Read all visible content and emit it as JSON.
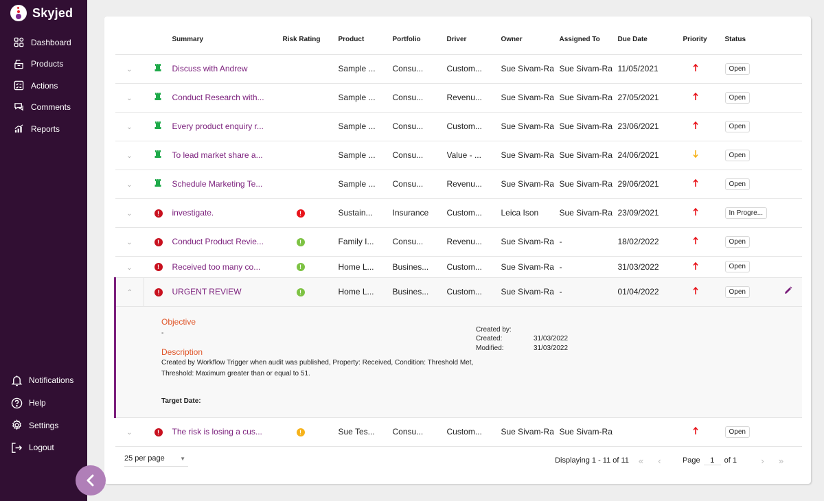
{
  "app": {
    "name": "Skyjed"
  },
  "sidebar": {
    "items": [
      {
        "label": "Dashboard",
        "icon": "dashboard-icon"
      },
      {
        "label": "Products",
        "icon": "products-icon"
      },
      {
        "label": "Actions",
        "icon": "actions-icon"
      },
      {
        "label": "Comments",
        "icon": "comments-icon"
      },
      {
        "label": "Reports",
        "icon": "reports-icon"
      }
    ],
    "bottom_items": [
      {
        "label": "Notifications",
        "icon": "bell-icon"
      },
      {
        "label": "Help",
        "icon": "help-icon"
      },
      {
        "label": "Settings",
        "icon": "gear-icon"
      },
      {
        "label": "Logout",
        "icon": "logout-icon"
      }
    ],
    "collapse_icon": "chevron-left-icon"
  },
  "table": {
    "columns": [
      "",
      "",
      "Summary",
      "Risk Rating",
      "Product",
      "Portfolio",
      "Driver",
      "Owner",
      "Assigned To",
      "Due Date",
      "Priority",
      "Status"
    ],
    "rows": [
      {
        "type": "tower",
        "summary": "Discuss with Andrew",
        "risk": "",
        "product": "Sample ...",
        "portfolio": "Consu...",
        "driver": "Custom...",
        "owner": "Sue Sivam-Ra",
        "assigned": "Sue Sivam-Ra",
        "due": "11/05/2021",
        "priority": "up",
        "status": "Open"
      },
      {
        "type": "tower",
        "summary": "Conduct Research with...",
        "risk": "",
        "product": "Sample ...",
        "portfolio": "Consu...",
        "driver": "Revenu...",
        "owner": "Sue Sivam-Ra",
        "assigned": "Sue Sivam-Ra",
        "due": "27/05/2021",
        "priority": "up",
        "status": "Open"
      },
      {
        "type": "tower",
        "summary": "Every product enquiry r...",
        "risk": "",
        "product": "Sample ...",
        "portfolio": "Consu...",
        "driver": "Custom...",
        "owner": "Sue Sivam-Ra",
        "assigned": "Sue Sivam-Ra",
        "due": "23/06/2021",
        "priority": "up",
        "status": "Open"
      },
      {
        "type": "tower",
        "summary": "To lead market share a...",
        "risk": "",
        "product": "Sample ...",
        "portfolio": "Consu...",
        "driver": "Value - ...",
        "owner": "Sue Sivam-Ra",
        "assigned": "Sue Sivam-Ra",
        "due": "24/06/2021",
        "priority": "down",
        "status": "Open"
      },
      {
        "type": "tower",
        "summary": "Schedule Marketing Te...",
        "risk": "",
        "product": "Sample ...",
        "portfolio": "Consu...",
        "driver": "Revenu...",
        "owner": "Sue Sivam-Ra",
        "assigned": "Sue Sivam-Ra",
        "due": "29/06/2021",
        "priority": "up",
        "status": "Open"
      },
      {
        "type": "alert",
        "summary": "investigate.",
        "risk": "red",
        "product": "Sustain...",
        "portfolio": "Insurance",
        "driver": "Custom...",
        "owner": "Leica Ison",
        "assigned": "Sue Sivam-Ra",
        "due": "23/09/2021",
        "priority": "up",
        "status": "In Progre..."
      },
      {
        "type": "alert",
        "summary": "Conduct Product Revie...",
        "risk": "green",
        "product": "Family I...",
        "portfolio": "Consu...",
        "driver": "Revenu...",
        "owner": "Sue Sivam-Ra",
        "assigned": "-",
        "due": "18/02/2022",
        "priority": "up",
        "status": "Open"
      },
      {
        "type": "alert",
        "summary": "Received too many co...",
        "risk": "green",
        "product": "Home L...",
        "portfolio": "Busines...",
        "driver": "Custom...",
        "owner": "Sue Sivam-Ra",
        "assigned": "-",
        "due": "31/03/2022",
        "priority": "up",
        "status": "Open",
        "partial": true
      },
      {
        "type": "alert",
        "summary": "URGENT REVIEW",
        "risk": "green",
        "product": "Home L...",
        "portfolio": "Busines...",
        "driver": "Custom...",
        "owner": "Sue Sivam-Ra",
        "assigned": "-",
        "due": "01/04/2022",
        "priority": "up",
        "status": "Open",
        "expanded": true
      },
      {
        "type": "alert",
        "summary": "The risk is losing a cus...",
        "risk": "yellow",
        "product": "Sue Tes...",
        "portfolio": "Consu...",
        "driver": "Custom...",
        "owner": "Sue Sivam-Ra",
        "assigned": "Sue Sivam-Ra",
        "due": "",
        "priority": "up",
        "status": "Open"
      }
    ]
  },
  "detail": {
    "objective_label": "Objective",
    "objective_value": "-",
    "description_label": "Description",
    "description_value": "Created by Workflow Trigger when audit was published, Property: Received, Condition: Threshold Met, Threshold: Maximum greater than or equal to 51.",
    "target_date_label": "Target Date:",
    "created_by_label": "Created by:",
    "created_by_value": "",
    "created_label": "Created:",
    "created_value": "31/03/2022",
    "modified_label": "Modified:",
    "modified_value": "31/03/2022"
  },
  "pagination": {
    "per_page": "25 per page",
    "displaying": "Displaying 1 - 11 of 11",
    "page_label": "Page",
    "page_value": "1",
    "of_label": "of 1"
  },
  "colors": {
    "sidebar_bg": "#310f33",
    "link": "#7b1f7c",
    "accent_orange": "#e0562a",
    "priority_up": "#e8141b",
    "priority_down": "#f6b21a"
  }
}
